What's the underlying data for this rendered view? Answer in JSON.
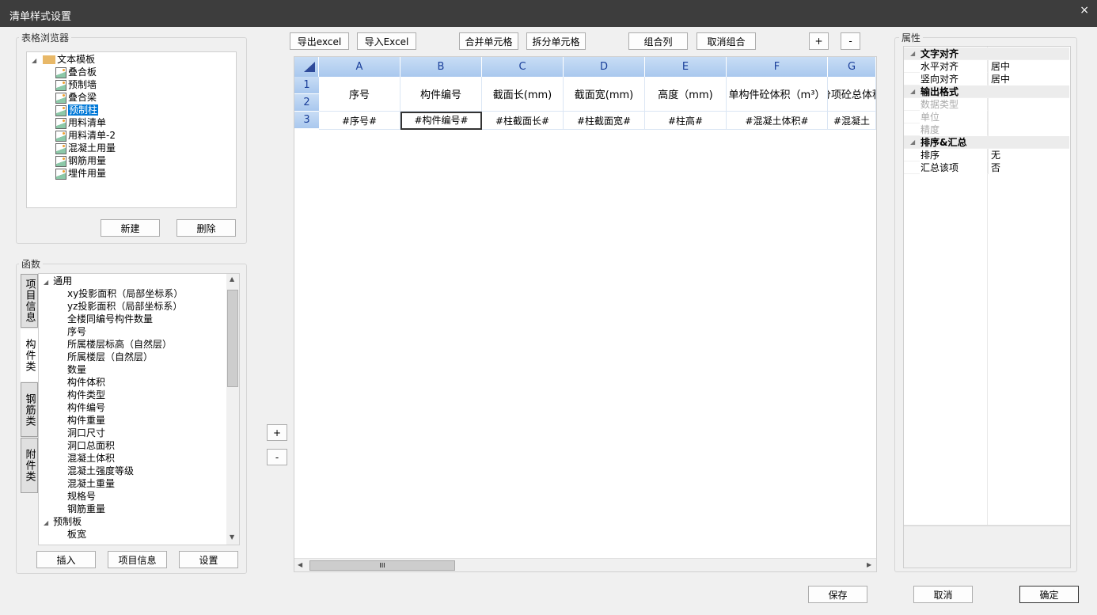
{
  "window": {
    "title": "清单样式设置",
    "close": "×"
  },
  "browser": {
    "label": "表格浏览器",
    "root": "文本模板",
    "items": [
      "叠合板",
      "预制墙",
      "叠合梁",
      "预制柱",
      "用料清单",
      "用料清单-2",
      "混凝土用量",
      "钢筋用量",
      "埋件用量"
    ],
    "selected": "预制柱",
    "new": "新建",
    "delete": "删除"
  },
  "functions": {
    "label": "函数",
    "tabs": [
      "项目信息",
      "构件类",
      "钢筋类",
      "附件类"
    ],
    "active_tab": "构件类",
    "categories": [
      {
        "name": "通用",
        "items": [
          "xy投影面积（局部坐标系）",
          "yz投影面积（局部坐标系）",
          "全楼同编号构件数量",
          "序号",
          "所属楼层标高（自然层）",
          "所属楼层（自然层）",
          "数量",
          "构件体积",
          "构件类型",
          "构件编号",
          "构件重量",
          "洞口尺寸",
          "洞口总面积",
          "混凝土体积",
          "混凝土强度等级",
          "混凝土重量",
          "规格号",
          "钢筋重量"
        ]
      },
      {
        "name": "预制板",
        "items": [
          "板宽"
        ]
      }
    ],
    "insert": "插入",
    "project_info": "项目信息",
    "settings": "设置"
  },
  "toolbar": {
    "export": "导出excel",
    "import": "导入Excel",
    "merge": "合并单元格",
    "split": "拆分单元格",
    "group": "组合列",
    "ungroup": "取消组合",
    "add": "+",
    "remove": "-"
  },
  "side_buttons": {
    "add": "+",
    "remove": "-"
  },
  "grid": {
    "columns": [
      "A",
      "B",
      "C",
      "D",
      "E",
      "F",
      "G"
    ],
    "rows": [
      "1",
      "2",
      "3"
    ],
    "header": [
      "序号",
      "构件编号",
      "截面长(mm)",
      "截面宽(mm)",
      "高度（mm)",
      "单构件砼体积（m³）",
      "分项砼总体积"
    ],
    "row3": [
      "#序号#",
      "#构件编号#",
      "#柱截面长#",
      "#柱截面宽#",
      "#柱高#",
      "#混凝土体积#",
      "#混凝土"
    ],
    "selected_cell": "B3",
    "scroll_thumb": "III"
  },
  "properties": {
    "label": "属性",
    "groups": [
      {
        "name": "文字对齐",
        "rows": [
          {
            "k": "水平对齐",
            "v": "居中"
          },
          {
            "k": "竖向对齐",
            "v": "居中"
          }
        ]
      },
      {
        "name": "输出格式",
        "rows": [
          {
            "k": "数据类型",
            "v": ""
          },
          {
            "k": "单位",
            "v": ""
          },
          {
            "k": "精度",
            "v": ""
          }
        ]
      },
      {
        "name": "排序&汇总",
        "rows": [
          {
            "k": "排序",
            "v": "无"
          },
          {
            "k": "汇总该项",
            "v": "否"
          }
        ]
      }
    ]
  },
  "footer": {
    "save": "保存",
    "cancel": "取消",
    "ok": "确定"
  }
}
